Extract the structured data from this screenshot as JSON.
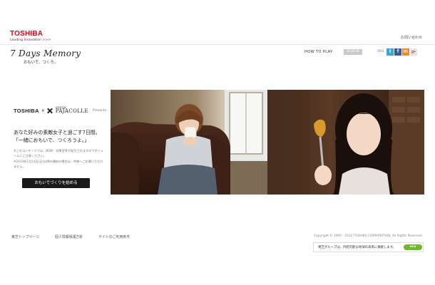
{
  "header": {
    "brand": "TOSHIBA",
    "tagline": "Leading Innovation",
    "tagline_arrows": ">>>",
    "contact": "お問い合わせ"
  },
  "site": {
    "title": "7 Days Memory",
    "subtitle": "おもいで、つくろ。"
  },
  "nav": {
    "how_to_play": "HOW TO PLAY",
    "badge": "SIGN IN",
    "sns_label": "SNS",
    "icons": [
      "twitter-icon",
      "facebook-icon",
      "mixi-icon",
      "google-plus-icon"
    ]
  },
  "promo": {
    "partner_brand": "TOSHIBA",
    "partner_x": "×",
    "partner_small": "写真家直撮",
    "partner_name": "PAJACOLLE",
    "presents": "Presents",
    "headline_1": "あなた好みの素敵女子と過ごす7日間。",
    "headline_2": "「一緒におもいで、つくろうよ。」",
    "note_1": "※このコンテンツでは、BGM、効果音等が発生されますのでボリュームにご注意ください。",
    "note_2": "※2013年1月13日(日)以降の開始の場合は、特典へご応募いただけません。",
    "cta": "おもいでづくりを始める"
  },
  "footer": {
    "links": [
      "東芝トップページ",
      "個人情報保護方針",
      "サイトのご利用条件"
    ],
    "copyright": "Copyright  ©  1995 - 2012 TOSHIBA CORPORATION, All Rights Reserved.",
    "eco_text": "東芝グループは、持続可能な地球の未来に貢献します。",
    "eco_badge": "eco"
  },
  "colors": {
    "brand_red": "#e60012",
    "cta_bg": "#1a1a1a",
    "eco_green": "#6fb92c"
  }
}
